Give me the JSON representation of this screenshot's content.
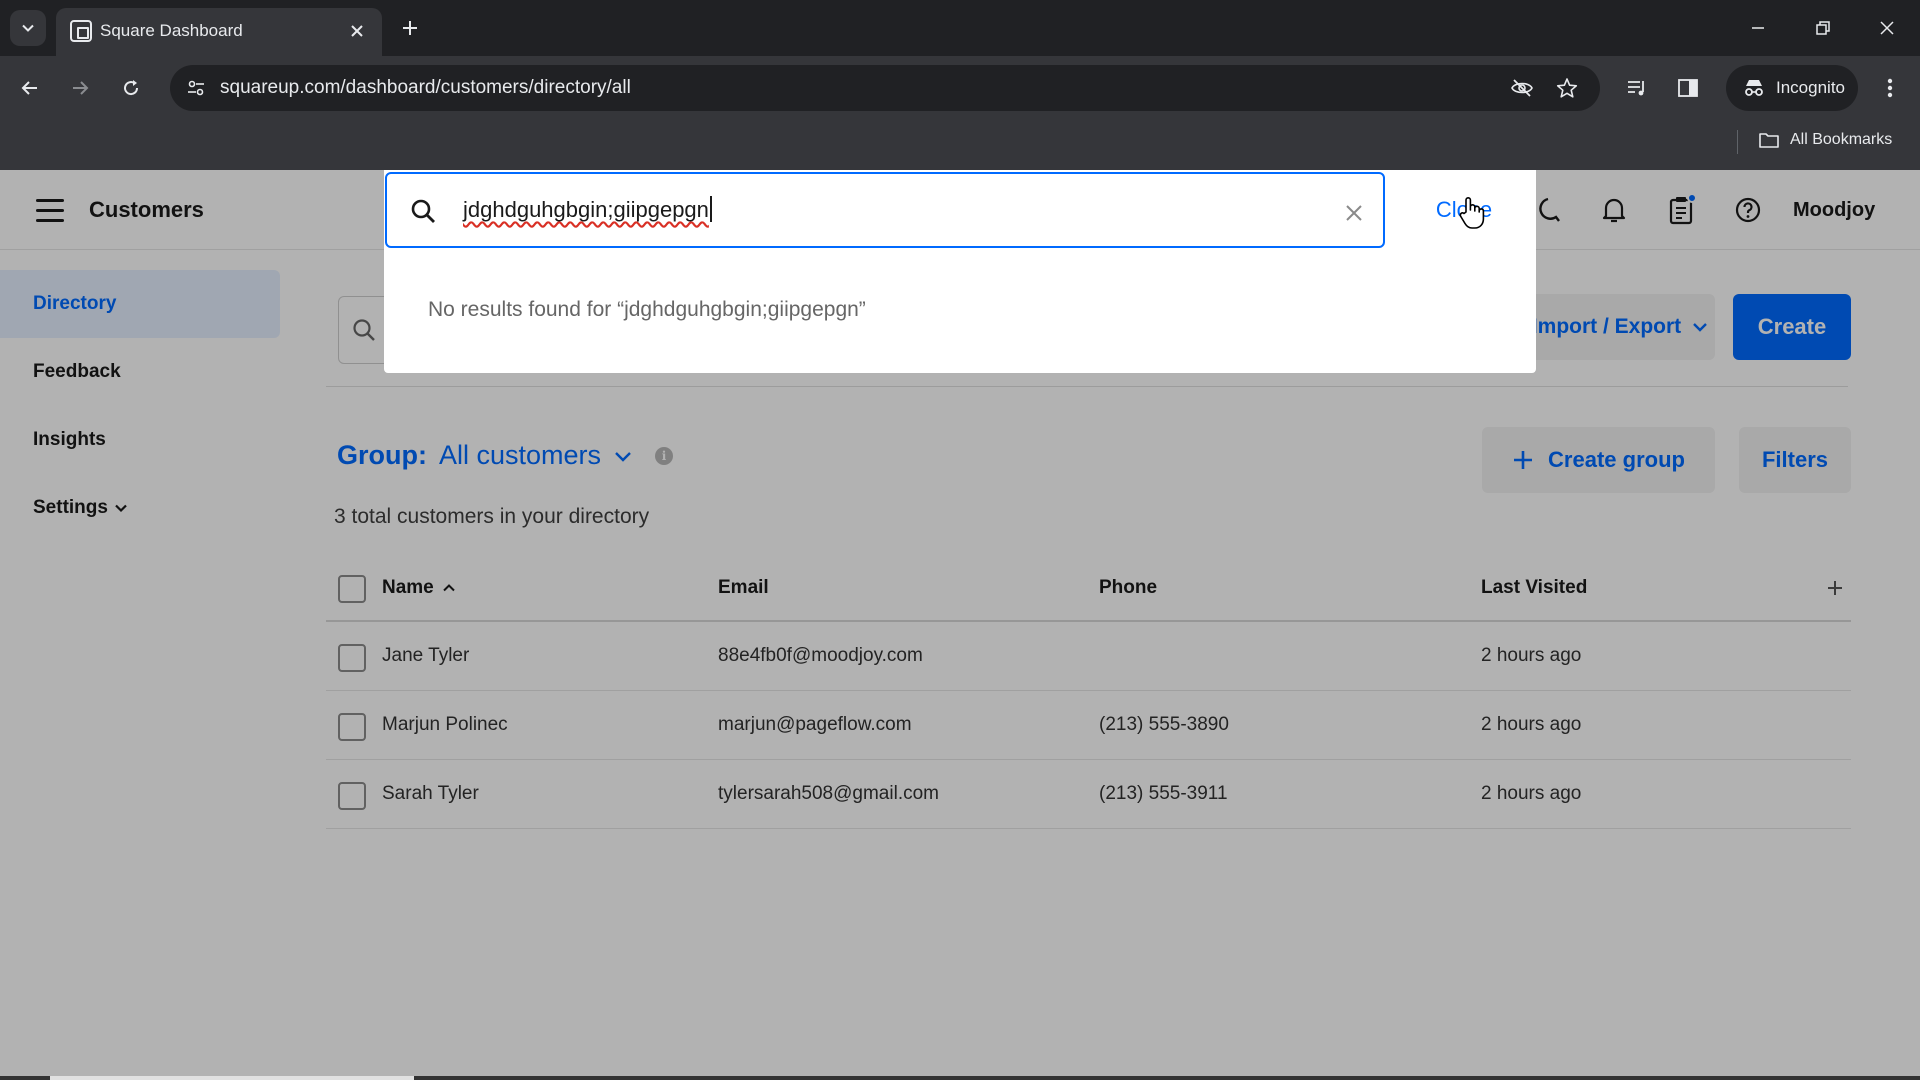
{
  "browser": {
    "tab_title": "Square Dashboard",
    "url": "squareup.com/dashboard/customers/directory/all",
    "incognito_label": "Incognito",
    "all_bookmarks": "All Bookmarks"
  },
  "app": {
    "title": "Customers",
    "account_name": "Moodjoy"
  },
  "sidebar": {
    "items": [
      {
        "label": "Directory",
        "active": true
      },
      {
        "label": "Feedback"
      },
      {
        "label": "Insights"
      },
      {
        "label": "Settings"
      }
    ]
  },
  "toolbar": {
    "import_export_label": "Import / Export",
    "create_label": "Create"
  },
  "group": {
    "label": "Group:",
    "value": "All customers",
    "create_group_label": "Create group",
    "filters_label": "Filters",
    "total_text": "3 total customers in your directory"
  },
  "table": {
    "columns": [
      "Name",
      "Email",
      "Phone",
      "Last Visited"
    ],
    "rows": [
      {
        "name": "Jane Tyler",
        "email": "88e4fb0f@moodjoy.com",
        "phone": "",
        "last_visited": "2 hours ago"
      },
      {
        "name": "Marjun Polinec",
        "email": "marjun@pageflow.com",
        "phone": "(213) 555-3890",
        "last_visited": "2 hours ago"
      },
      {
        "name": "Sarah Tyler",
        "email": "tylersarah508@gmail.com",
        "phone": "(213) 555-3911",
        "last_visited": "2 hours ago"
      }
    ]
  },
  "search_overlay": {
    "query": "jdghdguhgbgin;giipgepgn",
    "close_label": "Close",
    "no_results": "No results found for “jdghdguhgbgin;giipgepgn”"
  },
  "colors": {
    "accent": "#006aff",
    "active_sidebar_bg": "#e6f0ff",
    "chrome_dark": "#202124",
    "chrome_mid": "#35363a"
  }
}
